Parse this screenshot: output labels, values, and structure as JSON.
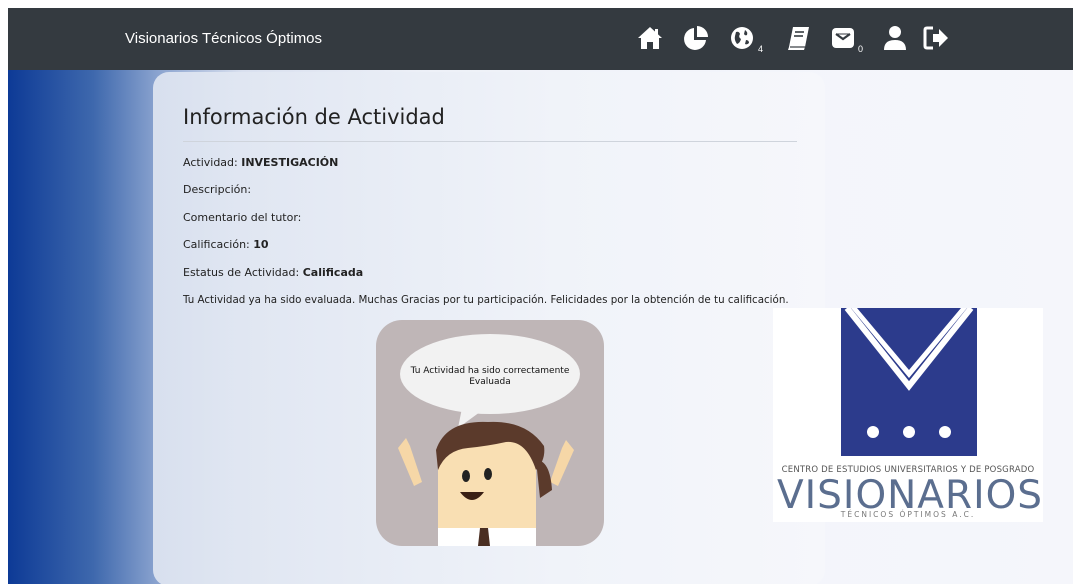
{
  "header": {
    "brand": "Visionarios Técnicos Óptimos",
    "nav": [
      {
        "icon": "home-icon"
      },
      {
        "icon": "pie-chart-icon"
      },
      {
        "icon": "globe-icon",
        "badge": "4"
      },
      {
        "icon": "book-icon"
      },
      {
        "icon": "envelope-icon",
        "badge": "0"
      },
      {
        "icon": "user-icon"
      },
      {
        "icon": "sign-out-icon"
      }
    ]
  },
  "card": {
    "title": "Información de Actividad",
    "activity_label": "Actividad:",
    "activity_value": "INVESTIGACIÓN",
    "description_label": "Descripción:",
    "description_value": "",
    "tutor_comment_label": "Comentario del tutor:",
    "tutor_comment_value": "",
    "grade_label": "Calificación:",
    "grade_value": "10",
    "status_label": "Estatus de Actividad:",
    "status_value": "Calificada",
    "message": "Tu Actividad ya ha sido evaluada. Muchas Gracias por tu participación. Felicidades por la obtención de tu calificación."
  },
  "illustration": {
    "bubble_text": "Tu Actividad ha sido correctamente Evaluada"
  },
  "logo": {
    "subtitle": "CENTRO DE ESTUDIOS UNIVERSITARIOS Y DE POSGRADO",
    "name": "VISIONARIOS",
    "tagline": "TÉCNICOS ÓPTIMOS A.C."
  },
  "colors": {
    "topbar": "#343a40",
    "logo_navy": "#2c3b8c",
    "gradient_left": "#0d3a96"
  }
}
